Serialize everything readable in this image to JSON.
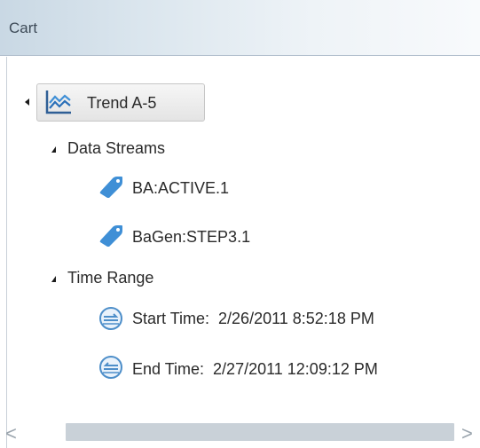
{
  "header": {
    "title": "Cart"
  },
  "tree": {
    "root": {
      "label": "Trend A-5",
      "icon": "trend-chart-icon"
    },
    "data_streams": {
      "label": "Data Streams",
      "items": [
        {
          "label": "BA:ACTIVE.1",
          "icon": "tag-icon"
        },
        {
          "label": "BaGen:STEP3.1",
          "icon": "tag-icon"
        }
      ]
    },
    "time_range": {
      "label": "Time Range",
      "start": {
        "label": "Start Time:",
        "value": "2/26/2011 8:52:18 PM",
        "icon": "start-time-icon"
      },
      "end": {
        "label": "End Time:",
        "value": "2/27/2011 12:09:12 PM",
        "icon": "end-time-icon"
      }
    }
  },
  "scrollbar": {
    "left_arrow": "<",
    "right_arrow": ">"
  },
  "colors": {
    "header_gradient_start": "#c9d8e4",
    "tag_blue": "#3f8fd6",
    "clock_blue": "#4d8ec9"
  }
}
